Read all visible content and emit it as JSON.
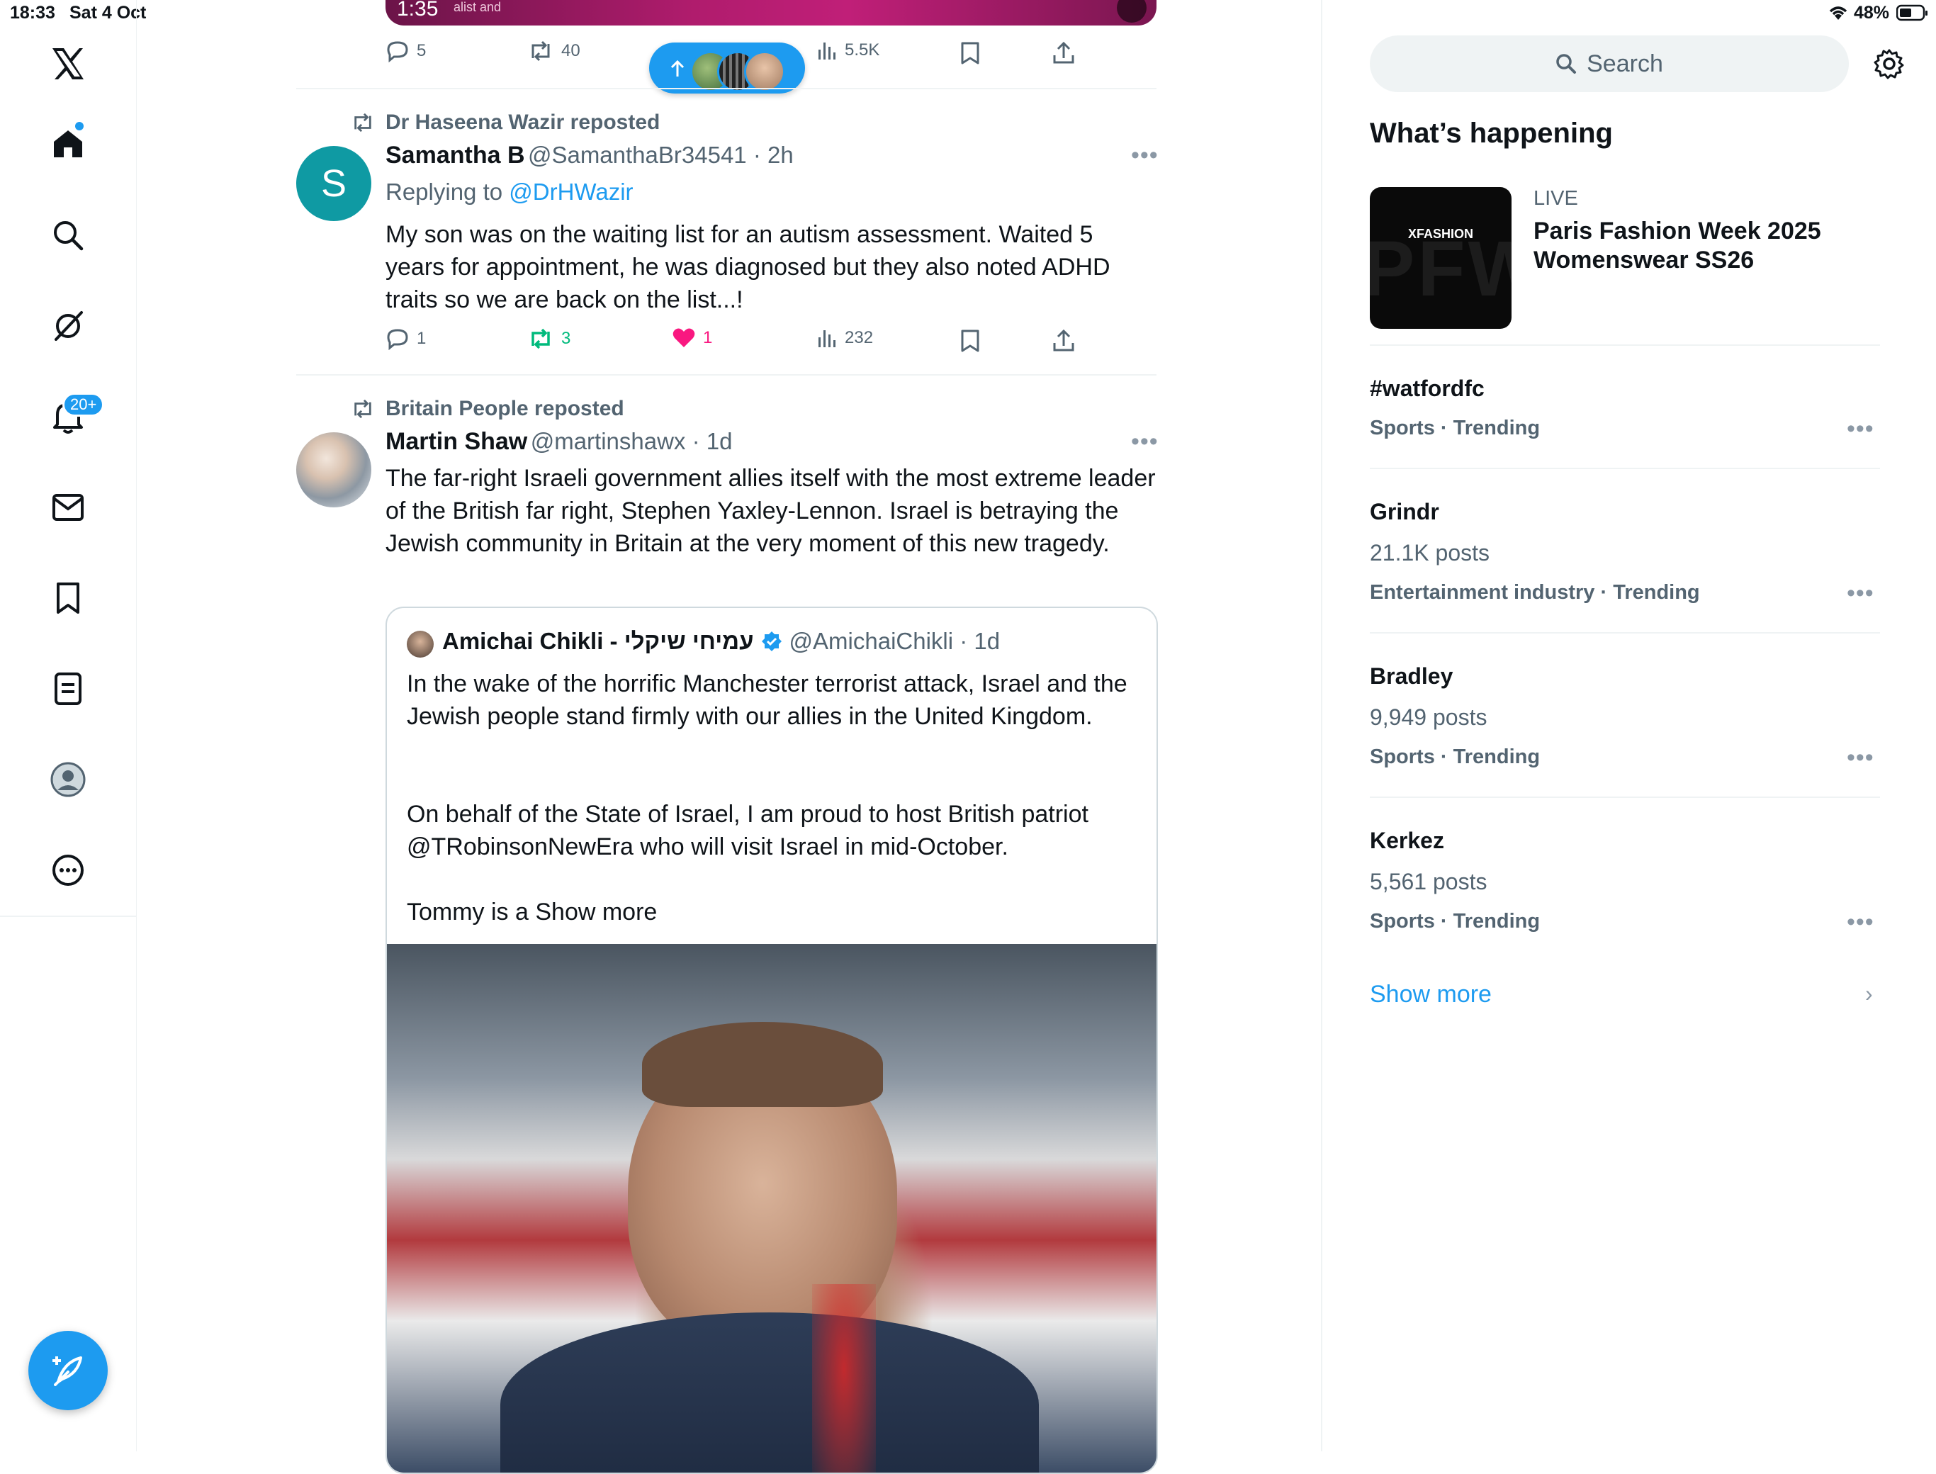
{
  "status_bar": {
    "time": "18:33",
    "date": "Sat 4 Oct",
    "battery": "48%"
  },
  "sidebar": {
    "notifications_badge": "20+"
  },
  "top_media": {
    "timestamp": "1:35",
    "caption": "alist and"
  },
  "top_actions": {
    "replies": "5",
    "reposts": "40",
    "views": "5.5K"
  },
  "tweets": [
    {
      "repost_by": "Dr Haseena Wazir reposted",
      "avatar_letter": "S",
      "name": "Samantha B",
      "handle_time": "@SamanthaBr34541 · 2h",
      "reply_prefix": "Replying to",
      "reply_to": "@DrHWazir",
      "text": "My son was on the waiting list for an autism assessment. Waited 5 years for appointment, he was diagnosed but they also noted ADHD traits so we are back on the list...!",
      "replies": "1",
      "reposts": "3",
      "likes": "1",
      "views": "232"
    },
    {
      "repost_by": "Britain People reposted",
      "name": "Martin Shaw",
      "handle_time": "@martinshawx · 1d",
      "text": "The far-right Israeli government allies itself with the most extreme leader of the British far right, Stephen Yaxley-Lennon. Israel is betraying the Jewish community in Britain at the very moment of this new tragedy.",
      "quote": {
        "name": "Amichai Chikli - עמיחי שיקלי",
        "handle_time": "@AmichaiChikli · 1d",
        "para1": "In the wake of the horrific Manchester terrorist attack, Israel and the Jewish people stand firmly with our allies in the United Kingdom.",
        "para2": "On behalf of the State of Israel, I am proud to host British patriot @TRobinsonNewEra who will visit Israel in mid-October.",
        "para3_prefix": "Tommy is a ",
        "show_more": "Show more"
      }
    }
  ],
  "right": {
    "search_placeholder": "Search",
    "section_title": "What’s happening",
    "live_event": {
      "label": "LIVE",
      "title": "Paris Fashion Week 2025 Womenswear SS26",
      "thumb_text": "XFASHION",
      "thumb_bg_text": "PFW"
    },
    "trends": [
      {
        "title": "#watfordfc",
        "count": "",
        "meta": "Sports · Trending"
      },
      {
        "title": "Grindr",
        "count": "21.1K posts",
        "meta": "Entertainment industry · Trending"
      },
      {
        "title": "Bradley",
        "count": "9,949 posts",
        "meta": "Sports · Trending"
      },
      {
        "title": "Kerkez",
        "count": "5,561 posts",
        "meta": "Sports · Trending"
      }
    ],
    "show_more": "Show more"
  },
  "colors": {
    "accent": "#1d9bf0",
    "like": "#f91880",
    "repost": "#00ba7c",
    "muted": "#536471"
  }
}
